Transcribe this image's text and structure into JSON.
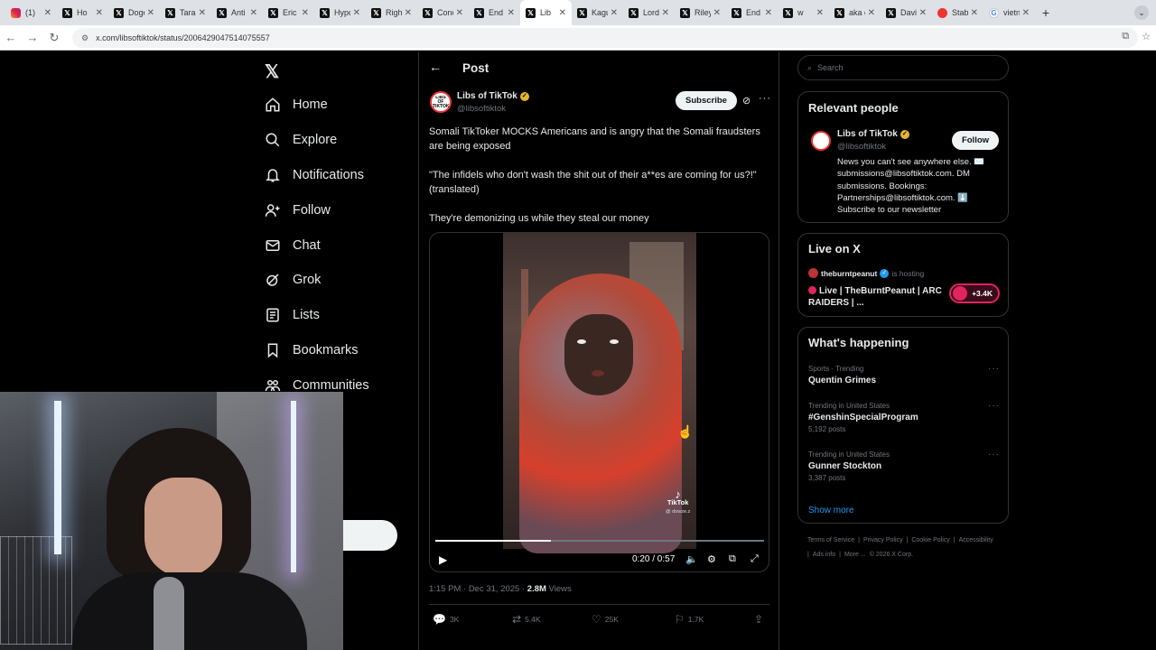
{
  "browser": {
    "tabs": [
      {
        "title": "(1)",
        "icon": "instagram-icon"
      },
      {
        "title": "Ho",
        "icon": "x-icon"
      },
      {
        "title": "DogeD",
        "icon": "x-icon"
      },
      {
        "title": "TaraBu",
        "icon": "x-icon"
      },
      {
        "title": "Anti W",
        "icon": "x-icon"
      },
      {
        "title": "Eric Da",
        "icon": "x-icon"
      },
      {
        "title": "Hypoc",
        "icon": "x-icon"
      },
      {
        "title": "Right A",
        "icon": "x-icon"
      },
      {
        "title": "Concer",
        "icon": "x-icon"
      },
      {
        "title": "End W",
        "icon": "x-icon"
      },
      {
        "title": "Lib",
        "icon": "x-icon",
        "active": true
      },
      {
        "title": "Kaguya",
        "icon": "x-icon"
      },
      {
        "title": "Lord Be",
        "icon": "x-icon"
      },
      {
        "title": "Riley G",
        "icon": "x-icon"
      },
      {
        "title": "End Wo",
        "icon": "x-icon"
      },
      {
        "title": "w",
        "icon": "x-icon"
      },
      {
        "title": "aka on",
        "icon": "x-icon"
      },
      {
        "title": "David S",
        "icon": "x-icon"
      },
      {
        "title": "Stable I",
        "icon": "red-icon"
      },
      {
        "title": "vietnam",
        "icon": "google-icon"
      }
    ],
    "url": "x.com/libsoftiktok/status/2006429047514075557"
  },
  "nav": {
    "logo": "𝕏",
    "items": [
      {
        "label": "Home",
        "icon": "home-icon"
      },
      {
        "label": "Explore",
        "icon": "search-icon"
      },
      {
        "label": "Notifications",
        "icon": "bell-icon"
      },
      {
        "label": "Follow",
        "icon": "person-plus-icon"
      },
      {
        "label": "Chat",
        "icon": "mail-icon"
      },
      {
        "label": "Grok",
        "icon": "grok-icon"
      },
      {
        "label": "Lists",
        "icon": "list-icon"
      },
      {
        "label": "Bookmarks",
        "icon": "bookmark-icon"
      },
      {
        "label": "Communities",
        "icon": "people-icon"
      }
    ]
  },
  "post": {
    "header_title": "Post",
    "author_name": "Libs of TikTok",
    "author_handle": "@libsoftiktok",
    "avatar_text": "LIBS OF TIKTOK",
    "subscribe_label": "Subscribe",
    "text_p1": "Somali TikToker MOCKS Americans and is angry that the Somali fraudsters are being exposed",
    "text_p2": "\"The infidels who don't wash the shit out of their a**es are coming for us?!\" (translated)",
    "text_p3": "They're demonizing us while they steal our money",
    "video": {
      "time": "0:20 / 0:57",
      "progress": 0.352,
      "watermark": "TikTok",
      "watermark_user": "@ dowze.z"
    },
    "time_label": "1:15 PM · Dec 31, 2025 · ",
    "views_count": "2.8M",
    "views_label": " Views",
    "replies": "3K",
    "reposts": "5.4K",
    "likes": "25K",
    "bookmarks": "1.7K"
  },
  "sidebar": {
    "search_placeholder": "Search",
    "relevant_title": "Relevant people",
    "rp_name": "Libs of TikTok",
    "rp_handle": "@libsoftiktok",
    "follow_label": "Follow",
    "rp_bio": "News you can't see anywhere else. ✉️ submissions@libsoftiktok.com. DM submissions. Bookings: Partnerships@libsoftiktok.com. ⬇️ Subscribe to our newsletter",
    "live_title": "Live on X",
    "live_host": "theburntpeanut",
    "live_hosting": "is hosting",
    "live_stream_title": "Live | TheBurntPeanut | ARC RAIDERS | ...",
    "live_count": "+3.4K",
    "happening_title": "What's happening",
    "trends": [
      {
        "context": "Sports · Trending",
        "name": "Quentin Grimes",
        "posts": ""
      },
      {
        "context": "Trending in United States",
        "name": "#GenshinSpecialProgram",
        "posts": "5,192 posts"
      },
      {
        "context": "Trending in United States",
        "name": "Gunner Stockton",
        "posts": "3,387 posts"
      }
    ],
    "show_more": "Show more",
    "footer": [
      "Terms of Service",
      "|",
      "Privacy Policy",
      "|",
      "Cookie Policy",
      "|",
      "Accessibility",
      "|",
      "Ads info",
      "|",
      "More ...",
      "© 2026 X Corp."
    ]
  }
}
